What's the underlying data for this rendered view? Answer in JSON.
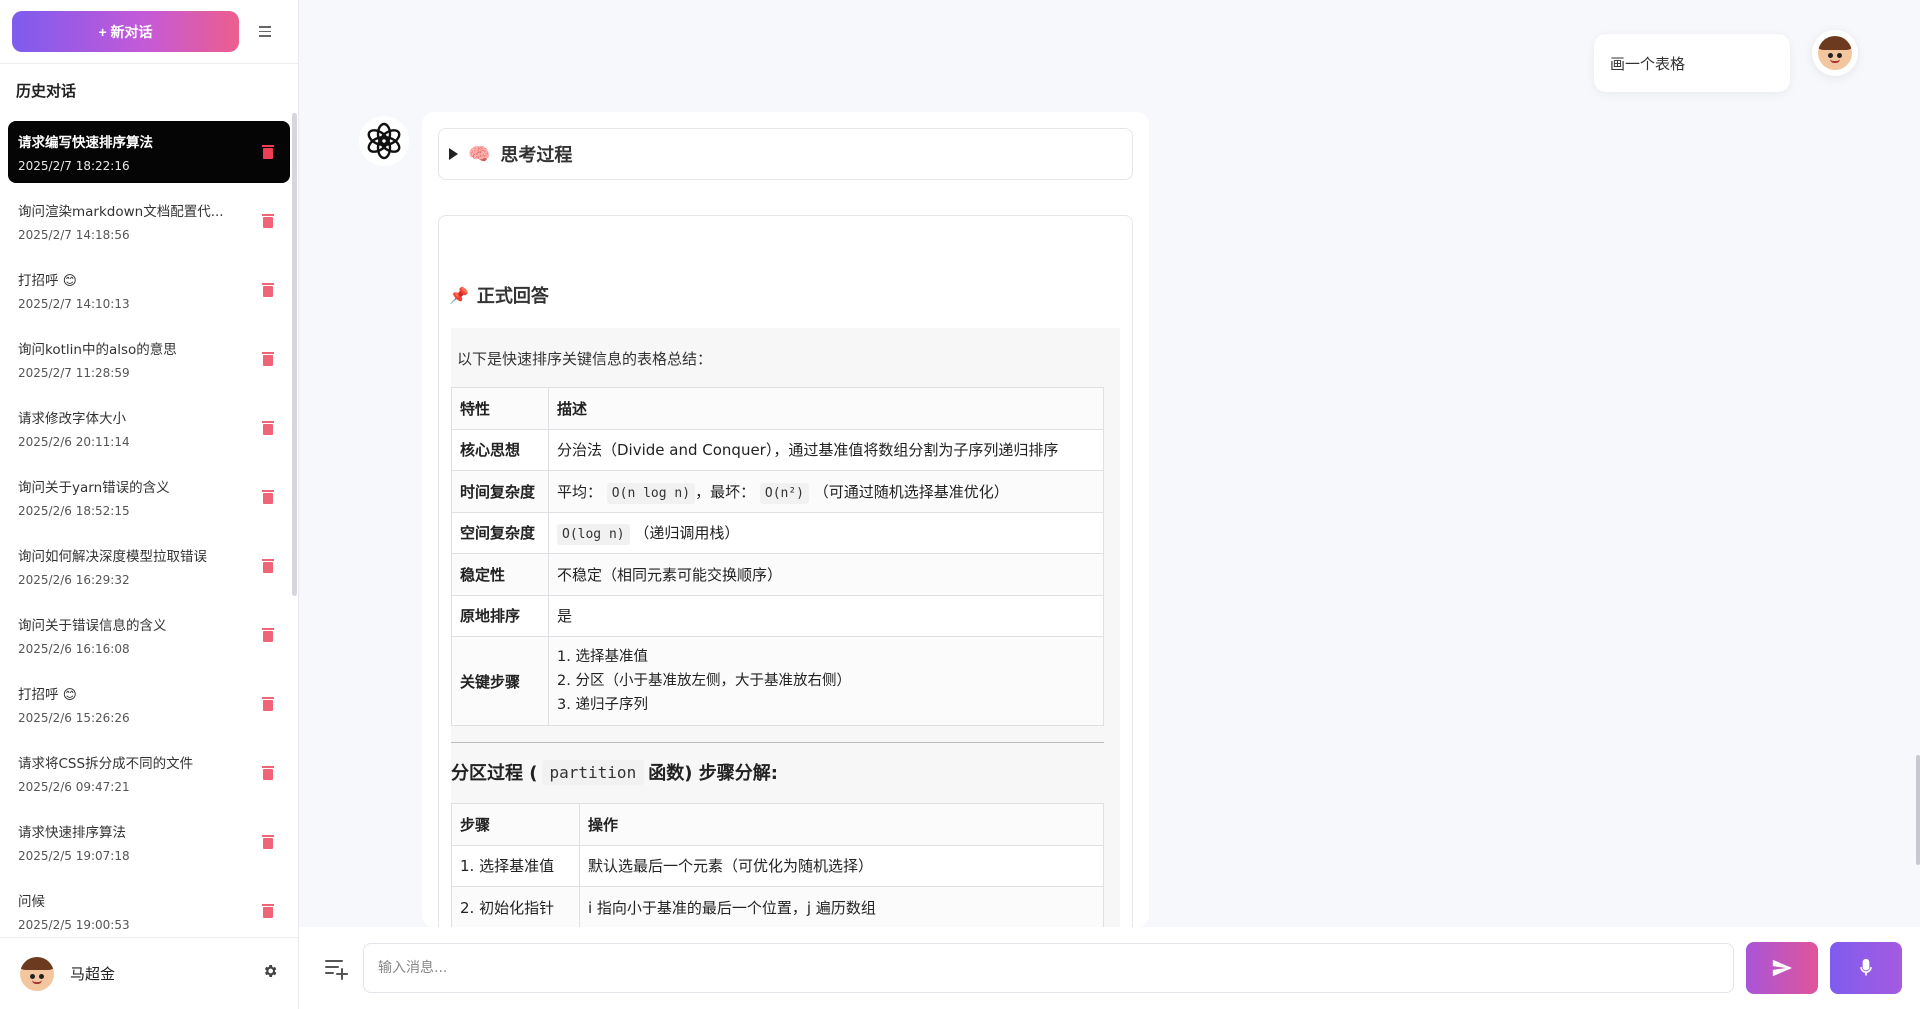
{
  "sidebar": {
    "new_chat_label": "+  新对话",
    "history_title": "历史对话",
    "items": [
      {
        "title": "请求编写快速排序算法",
        "time": "2025/2/7 18:22:16",
        "active": true
      },
      {
        "title": "询问渲染markdown文档配置代...",
        "time": "2025/2/7 14:18:56",
        "active": false
      },
      {
        "title": "打招呼 😊",
        "time": "2025/2/7 14:10:13",
        "active": false
      },
      {
        "title": "询问kotlin中的also的意思",
        "time": "2025/2/7 11:28:59",
        "active": false
      },
      {
        "title": "请求修改字体大小",
        "time": "2025/2/6 20:11:14",
        "active": false
      },
      {
        "title": "询问关于yarn错误的含义",
        "time": "2025/2/6 18:52:15",
        "active": false
      },
      {
        "title": "询问如何解决深度模型拉取错误",
        "time": "2025/2/6 16:29:32",
        "active": false
      },
      {
        "title": "询问关于错误信息的含义",
        "time": "2025/2/6 16:16:08",
        "active": false
      },
      {
        "title": "打招呼 😊",
        "time": "2025/2/6 15:26:26",
        "active": false
      },
      {
        "title": "请求将CSS拆分成不同的文件",
        "time": "2025/2/6 09:47:21",
        "active": false
      },
      {
        "title": "请求快速排序算法",
        "time": "2025/2/5 19:07:18",
        "active": false
      },
      {
        "title": "问候",
        "time": "2025/2/5 19:00:53",
        "active": false
      }
    ],
    "user_name": "马超金",
    "settings_icon": "gear-icon"
  },
  "chat": {
    "user_message": "画一个表格",
    "think_label": "思考过程",
    "formal_title": "正式回答",
    "intro": "以下是快速排序关键信息的表格总结：",
    "table1": {
      "headers": [
        "特性",
        "描述"
      ],
      "rows": [
        {
          "k": "核心思想",
          "v": "分治法（Divide and Conquer），通过基准值将数组分割为子序列递归排序"
        },
        {
          "k": "时间复杂度",
          "v_pre": "平均：",
          "v_code1": "O(n log n)",
          "v_mid": "，最坏：",
          "v_code2": "O(n²)",
          "v_post": "（可通过随机选择基准优化）"
        },
        {
          "k": "空间复杂度",
          "v_code1": "O(log n)",
          "v_post": "（递归调用栈）"
        },
        {
          "k": "稳定性",
          "v": "不稳定（相同元素可能交换顺序）"
        },
        {
          "k": "原地排序",
          "v": "是"
        },
        {
          "k": "关键步骤",
          "steps": [
            "1. 选择基准值",
            "2. 分区（小于基准放左侧，大于基准放右侧）",
            "3. 递归子序列"
          ]
        }
      ]
    },
    "sub_heading_pre": "分区过程 (",
    "sub_heading_code": "partition",
    "sub_heading_post": "函数) 步骤分解:",
    "table2": {
      "headers": [
        "步骤",
        "操作"
      ],
      "rows": [
        {
          "k": "1. 选择基准值",
          "v": "默认选最后一个元素（可优化为随机选择）"
        },
        {
          "k": "2. 初始化指针",
          "v": "i 指向小于基准的最后一个位置，j 遍历数组"
        }
      ]
    }
  },
  "input": {
    "placeholder": "输入消息..."
  },
  "colors": {
    "accent_gradient_start": "#7e5bef",
    "accent_gradient_end": "#ec5e8d",
    "active_item_bg": "#050505",
    "delete_icon": "#f06478"
  }
}
